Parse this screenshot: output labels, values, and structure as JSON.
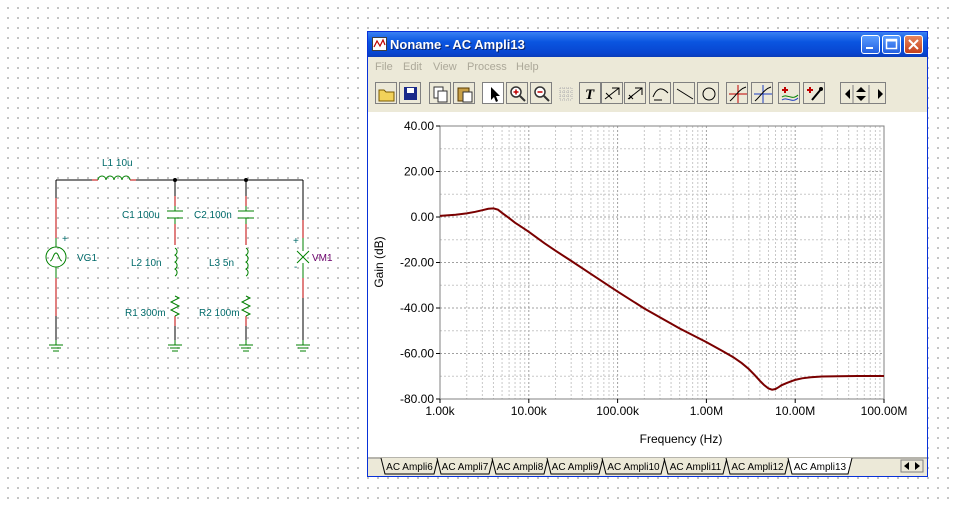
{
  "schematic": {
    "L1": "L1 10u",
    "C1": "C1 100u",
    "C2": "C2 100n",
    "L2": "L2 10n",
    "L3": "L3 5n",
    "R1": "R1 300m",
    "R2": "R2 100m",
    "VG1": "VG1",
    "VM1": "VM1",
    "plus": "+",
    "minus": "-"
  },
  "window": {
    "title": "Noname - AC Ampli13",
    "menu": [
      "File",
      "Edit",
      "View",
      "Process",
      "Help"
    ],
    "toolbar_icons": [
      "open-icon",
      "save-icon",
      "copy-icon",
      "paste-icon",
      "pointer-icon",
      "zoom-in-icon",
      "zoom-out-icon",
      "grid-icon",
      "text-icon",
      "cursor-a-icon",
      "cursor-b-icon",
      "curve-icon",
      "line-icon",
      "circle-icon",
      "marker-a-icon",
      "marker-b-icon",
      "trace-icon",
      "probe-icon",
      "scroll-icon"
    ],
    "tabs": [
      "AC Ampli6",
      "AC Ampli7",
      "AC Ampli8",
      "AC Ampli9",
      "AC Ampli10",
      "AC Ampli11",
      "AC Ampli12",
      "AC Ampli13"
    ],
    "active_tab": "AC Ampli13"
  },
  "chart_data": {
    "type": "line",
    "xlabel": "Frequency (Hz)",
    "ylabel": "Gain (dB)",
    "x_scale": "log",
    "xlim": [
      1000,
      100000000
    ],
    "ylim": [
      -80,
      40
    ],
    "x_ticks": [
      "1.00k",
      "10.00k",
      "100.00k",
      "1.00M",
      "10.00M",
      "100.00M"
    ],
    "y_ticks": [
      "40.00",
      "20.00",
      "0.00",
      "-20.00",
      "-40.00",
      "-60.00",
      "-80.00"
    ],
    "grid": true,
    "series": [
      {
        "color": "#7a0000",
        "x": [
          1000,
          1500,
          2000,
          2500,
          3000,
          3500,
          4000,
          4500,
          5000,
          6000,
          7000,
          8000,
          10000,
          15000,
          20000,
          30000,
          50000,
          100000,
          200000,
          500000,
          1000000,
          1500000,
          2000000,
          2500000,
          3000000,
          3500000,
          4000000,
          4500000,
          5000000,
          5500000,
          6000000,
          6500000,
          7000000,
          8000000,
          9000000,
          10000000,
          12000000,
          15000000,
          20000000,
          30000000,
          50000000,
          100000000
        ],
        "y": [
          0.5,
          1.0,
          1.6,
          2.3,
          3.0,
          3.6,
          3.8,
          3.2,
          1.8,
          -0.5,
          -2.5,
          -4.0,
          -6.5,
          -11.5,
          -14.8,
          -19.3,
          -25.0,
          -32.8,
          -40.2,
          -49.0,
          -55.0,
          -58.8,
          -61.6,
          -64.2,
          -66.8,
          -69.5,
          -72.0,
          -74.0,
          -75.4,
          -75.9,
          -75.6,
          -74.8,
          -74.0,
          -73.0,
          -72.2,
          -71.6,
          -70.9,
          -70.4,
          -70.1,
          -70.0,
          -69.9,
          -69.9
        ]
      }
    ]
  }
}
